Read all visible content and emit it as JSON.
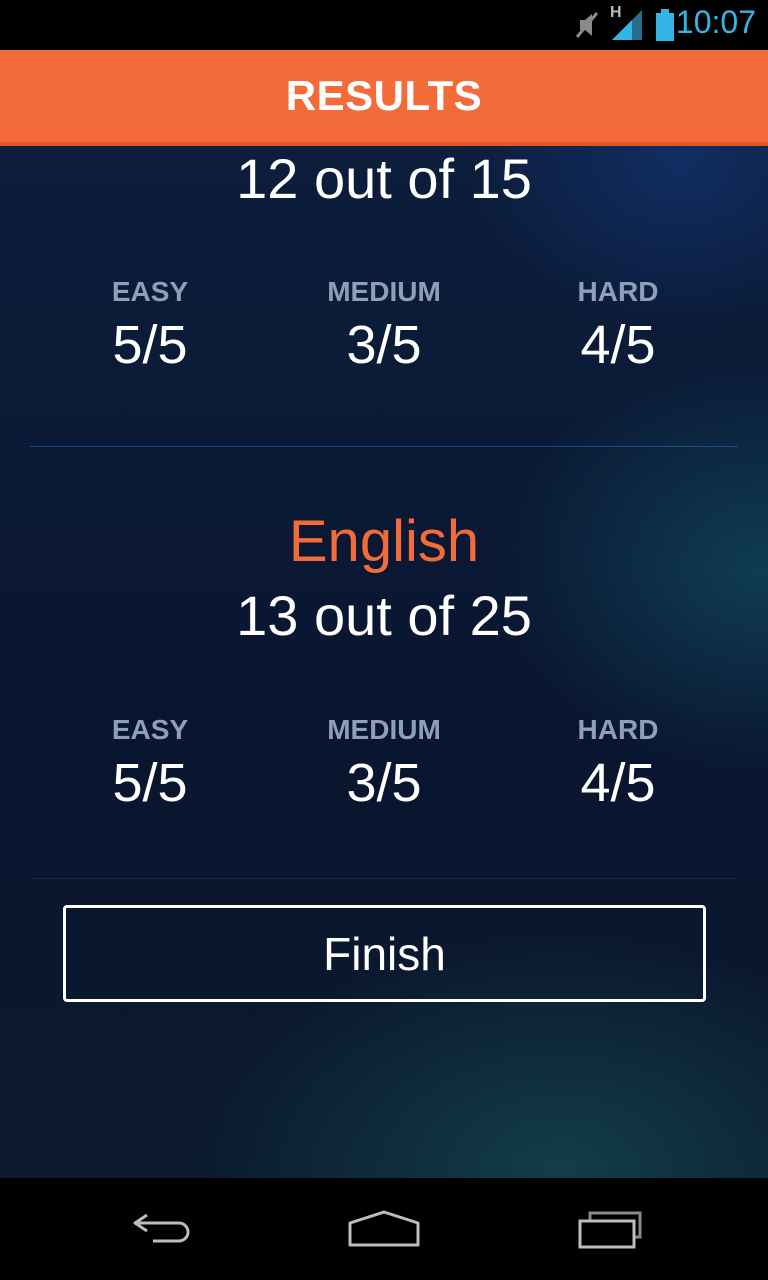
{
  "status_bar": {
    "time": "10:07",
    "network_label": "H",
    "icons": [
      "muted-icon",
      "signal-icon",
      "battery-icon"
    ],
    "accent": "#33b5e5"
  },
  "app_bar": {
    "title": "RESULTS",
    "color": "#f46b3a"
  },
  "sections": [
    {
      "subject": "",
      "score": "12 out of 15",
      "breakdown": [
        {
          "label": "EASY",
          "value": "5/5"
        },
        {
          "label": "MEDIUM",
          "value": "3/5"
        },
        {
          "label": "HARD",
          "value": "4/5"
        }
      ]
    },
    {
      "subject": "English",
      "score": "13 out of 25",
      "breakdown": [
        {
          "label": "EASY",
          "value": "5/5"
        },
        {
          "label": "MEDIUM",
          "value": "3/5"
        },
        {
          "label": "HARD",
          "value": "4/5"
        }
      ]
    }
  ],
  "finish_button": {
    "label": "Finish"
  },
  "nav_bar": {
    "icons": [
      "back-icon",
      "home-icon",
      "recent-apps-icon"
    ]
  }
}
